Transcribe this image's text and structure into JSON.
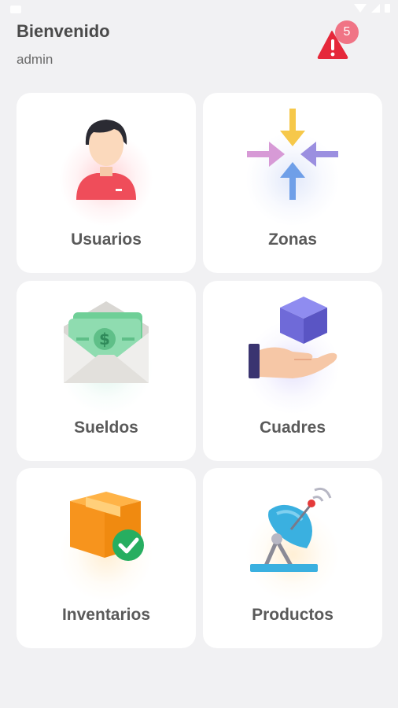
{
  "header": {
    "title": "Bienvenido",
    "user": "admin",
    "notification_count": "5"
  },
  "menu": {
    "items": [
      {
        "label": "Usuarios",
        "icon": "user-icon"
      },
      {
        "label": "Zonas",
        "icon": "arrows-converge-icon"
      },
      {
        "label": "Sueldos",
        "icon": "money-envelope-icon"
      },
      {
        "label": "Cuadres",
        "icon": "hand-cube-icon"
      },
      {
        "label": "Inventarios",
        "icon": "box-check-icon"
      },
      {
        "label": "Productos",
        "icon": "satellite-dish-icon"
      }
    ]
  },
  "colors": {
    "background": "#f1f1f3",
    "card": "#ffffff",
    "badge": "#f07485",
    "alert": "#e5283a"
  }
}
